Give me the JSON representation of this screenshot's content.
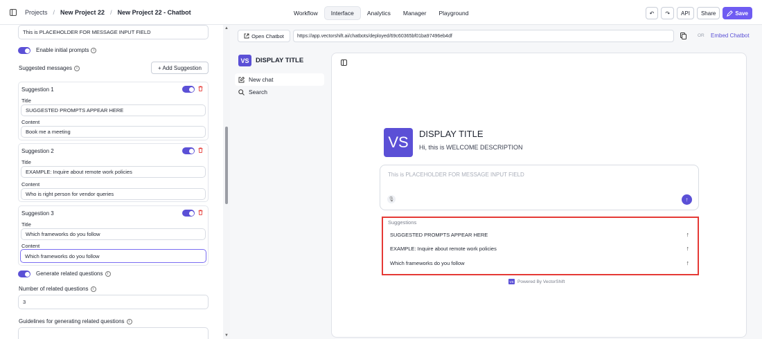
{
  "header": {
    "crumbs": [
      "Projects",
      "New Project 22",
      "New Project 22 - Chatbot"
    ],
    "separator": "/",
    "tabs": [
      "Workflow",
      "Interface",
      "Analytics",
      "Manager",
      "Playground"
    ],
    "active_tab": "Interface",
    "undo": "↶",
    "redo": "↷",
    "api": "API",
    "share": "Share",
    "save": "Save"
  },
  "left": {
    "placeholder_value": "This is PLACEHOLDER FOR MESSAGE INPUT FIELD",
    "enable_initial_prompts": "Enable initial prompts",
    "suggested_messages": "Suggested messages",
    "add_suggestion": "+ Add Suggestion",
    "title_label": "Title",
    "content_label": "Content",
    "suggestions": [
      {
        "name": "Suggestion 1",
        "title": "SUGGESTED PROMPTS APPEAR HERE",
        "content": "Book me a meeting"
      },
      {
        "name": "Suggestion 2",
        "title": "EXAMPLE: Inquire about remote work policies",
        "content": "Who is right person for vendor queries"
      },
      {
        "name": "Suggestion 3",
        "title": "Which frameworks do you follow",
        "content": "Which frameworks do you follow"
      }
    ],
    "generate_related": "Generate related questions",
    "number_related_label": "Number of related questions",
    "number_related_value": "3",
    "guidelines_label": "Guidelines for generating related questions"
  },
  "right": {
    "open_chatbot": "Open Chatbot",
    "url": "https://app.vectorshift.ai/chatbots/deployed/69c60365bf01ba97496eb4df",
    "or": "OR",
    "embed": "Embed Chatbot",
    "sidebar_logo": "VS",
    "sidebar_title": "DISPLAY TITLE",
    "new_chat": "New chat",
    "search": "Search",
    "preview_logo": "VS",
    "preview_title": "DISPLAY TITLE",
    "welcome": "Hi, this is WELCOME DESCRIPTION",
    "input_placeholder": "This is PLACEHOLDER FOR MESSAGE INPUT FIELD",
    "suggestions_header": "Suggestions",
    "suggestions": [
      "SUGGESTED PROMPTS APPEAR HERE",
      "EXAMPLE: Inquire about remote work policies",
      "Which frameworks do you follow"
    ],
    "powered_logo": "VS",
    "powered_by": "Powered By VectorShift"
  },
  "colors": {
    "accent": "#5b50d6",
    "highlight": "#e53935",
    "save": "#6f5cf2"
  }
}
